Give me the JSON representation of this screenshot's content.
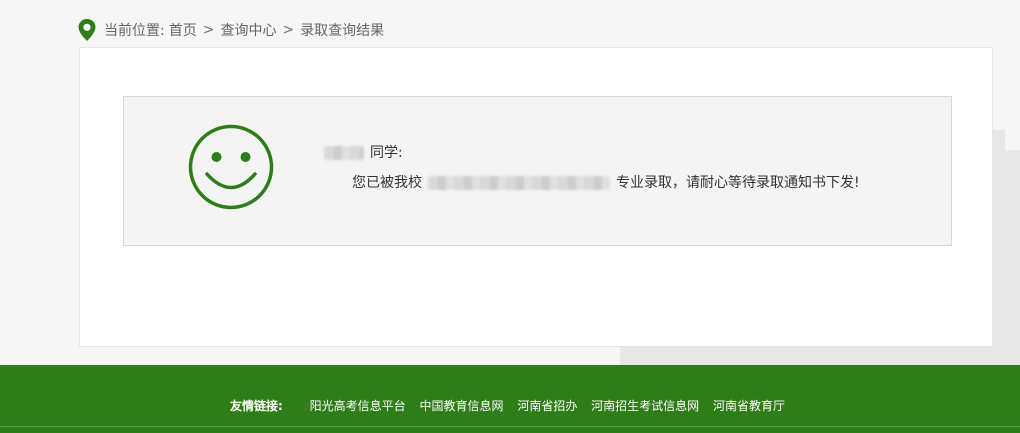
{
  "breadcrumb": {
    "prefix": "当前位置:",
    "items": [
      "首页",
      "查询中心",
      "录取查询结果"
    ],
    "separator": ">"
  },
  "result": {
    "greeting_suffix": "同学:",
    "message_prefix": "您已被我校",
    "message_suffix": "专业录取，请耐心等待录取通知书下发!"
  },
  "footer": {
    "label": "友情链接:",
    "links": [
      "阳光高考信息平台",
      "中国教育信息网",
      "河南省招办",
      "河南招生考试信息网",
      "河南省教育厅"
    ]
  },
  "colors": {
    "brand_green": "#2e7d18",
    "smiley_green": "#2e7d18"
  },
  "icons": {
    "location": "location-pin-icon",
    "result": "smiley-face-icon"
  }
}
